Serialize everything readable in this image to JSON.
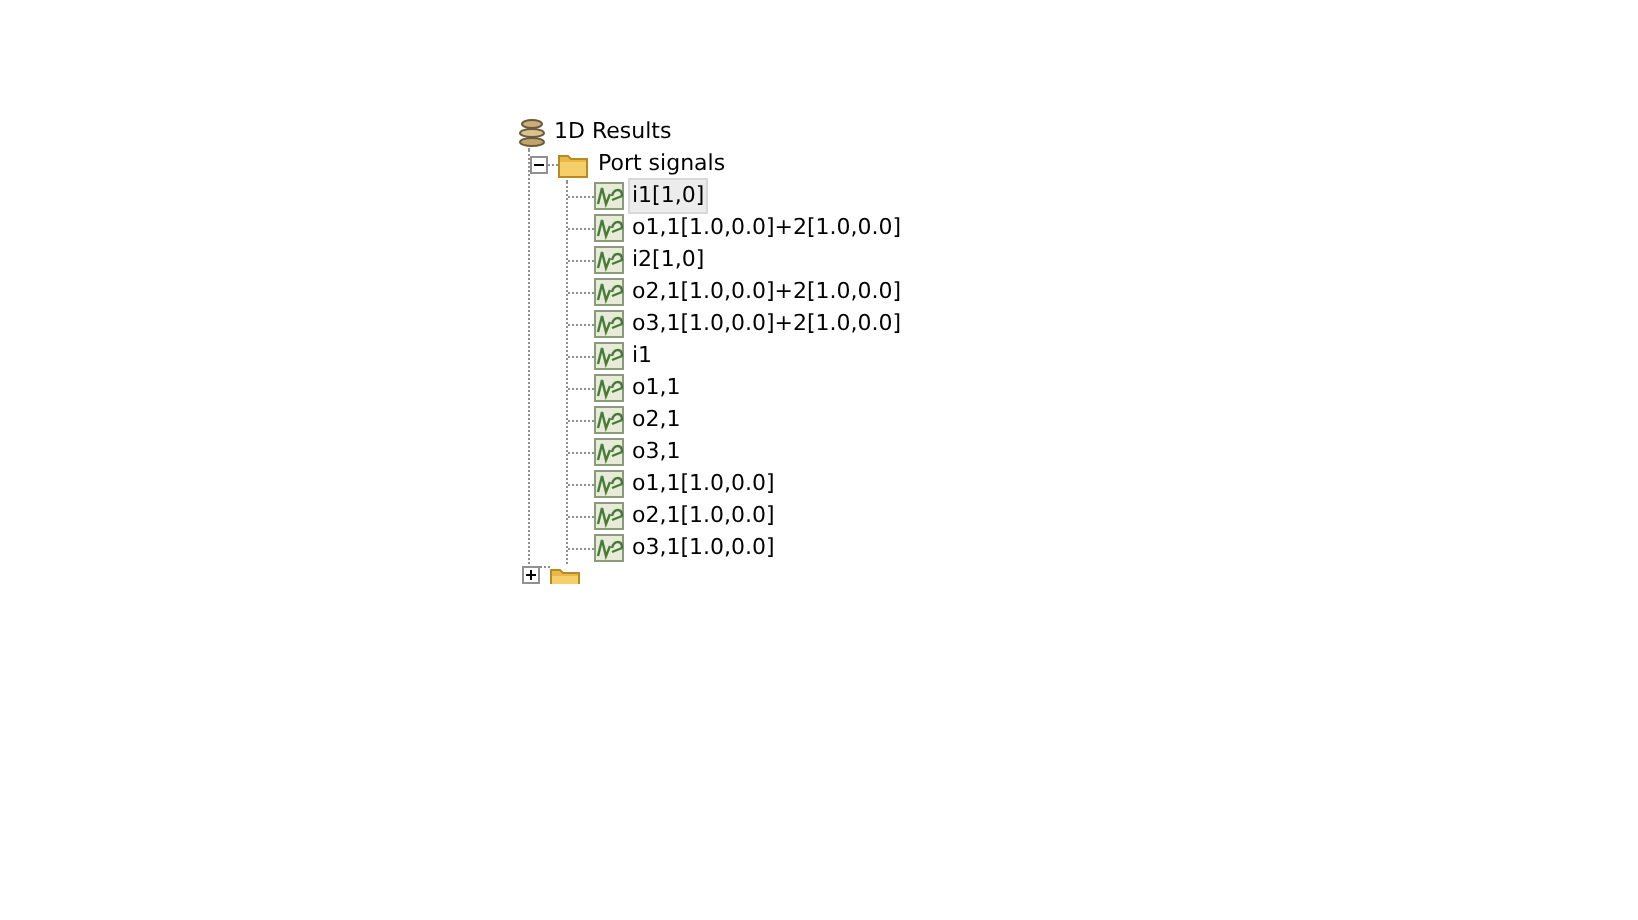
{
  "tree": {
    "label": "1D Results",
    "children": [
      {
        "label": "Port signals",
        "expanded": true,
        "children": [
          {
            "label": "i1[1,0]",
            "selected": true
          },
          {
            "label": "o1,1[1.0,0.0]+2[1.0,0.0]",
            "selected": false
          },
          {
            "label": "i2[1,0]",
            "selected": false
          },
          {
            "label": "o2,1[1.0,0.0]+2[1.0,0.0]",
            "selected": false
          },
          {
            "label": "o3,1[1.0,0.0]+2[1.0,0.0]",
            "selected": false
          },
          {
            "label": "i1",
            "selected": false
          },
          {
            "label": "o1,1",
            "selected": false
          },
          {
            "label": "o2,1",
            "selected": false
          },
          {
            "label": "o3,1",
            "selected": false
          },
          {
            "label": "o1,1[1.0,0.0]",
            "selected": false
          },
          {
            "label": "o2,1[1.0,0.0]",
            "selected": false
          },
          {
            "label": "o3,1[1.0,0.0]",
            "selected": false
          }
        ]
      },
      {
        "expanded": false
      }
    ]
  }
}
